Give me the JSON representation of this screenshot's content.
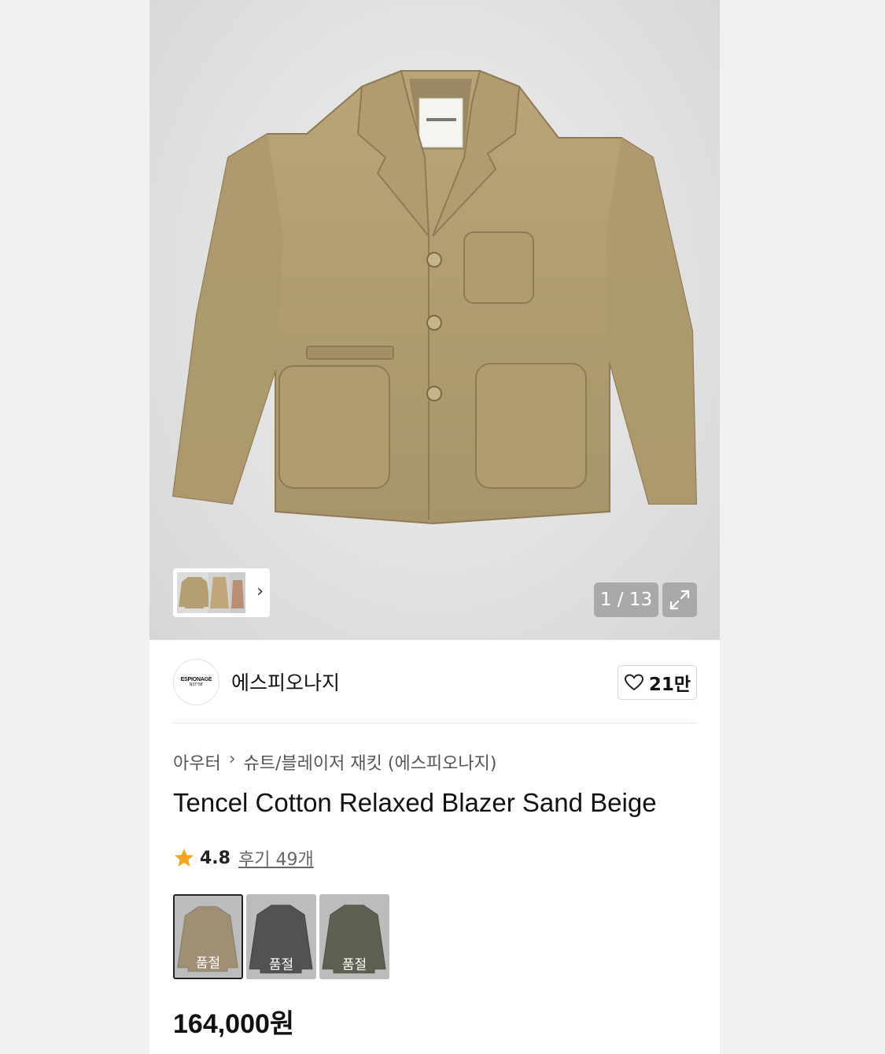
{
  "gallery": {
    "counter": "1 / 13",
    "expand_icon": "expand-icon",
    "thumb_next_icon": "chevron-right-icon",
    "jacket_color": "#b49f73"
  },
  "brand": {
    "logo_line1": "ESPIONAGE",
    "logo_line2": "N37°58'",
    "name": "에스피오나지",
    "like_count": "21만",
    "like_icon": "heart-icon"
  },
  "product": {
    "breadcrumb": [
      "아우터",
      "슈트/블레이저 재킷 (에스피오나지)"
    ],
    "title": "Tencel Cotton Relaxed Blazer Sand Beige",
    "rating": "4.8",
    "reviews": "후기 49개",
    "rating_icon": "star-icon",
    "star_color": "#f5a623",
    "price": "164,000원"
  },
  "swatches": [
    {
      "label": "품절",
      "color": "#b49f73",
      "selected": true
    },
    {
      "label": "품절",
      "color": "#3b3b3b",
      "selected": false
    },
    {
      "label": "품절",
      "color": "#4e5139",
      "selected": false
    }
  ]
}
